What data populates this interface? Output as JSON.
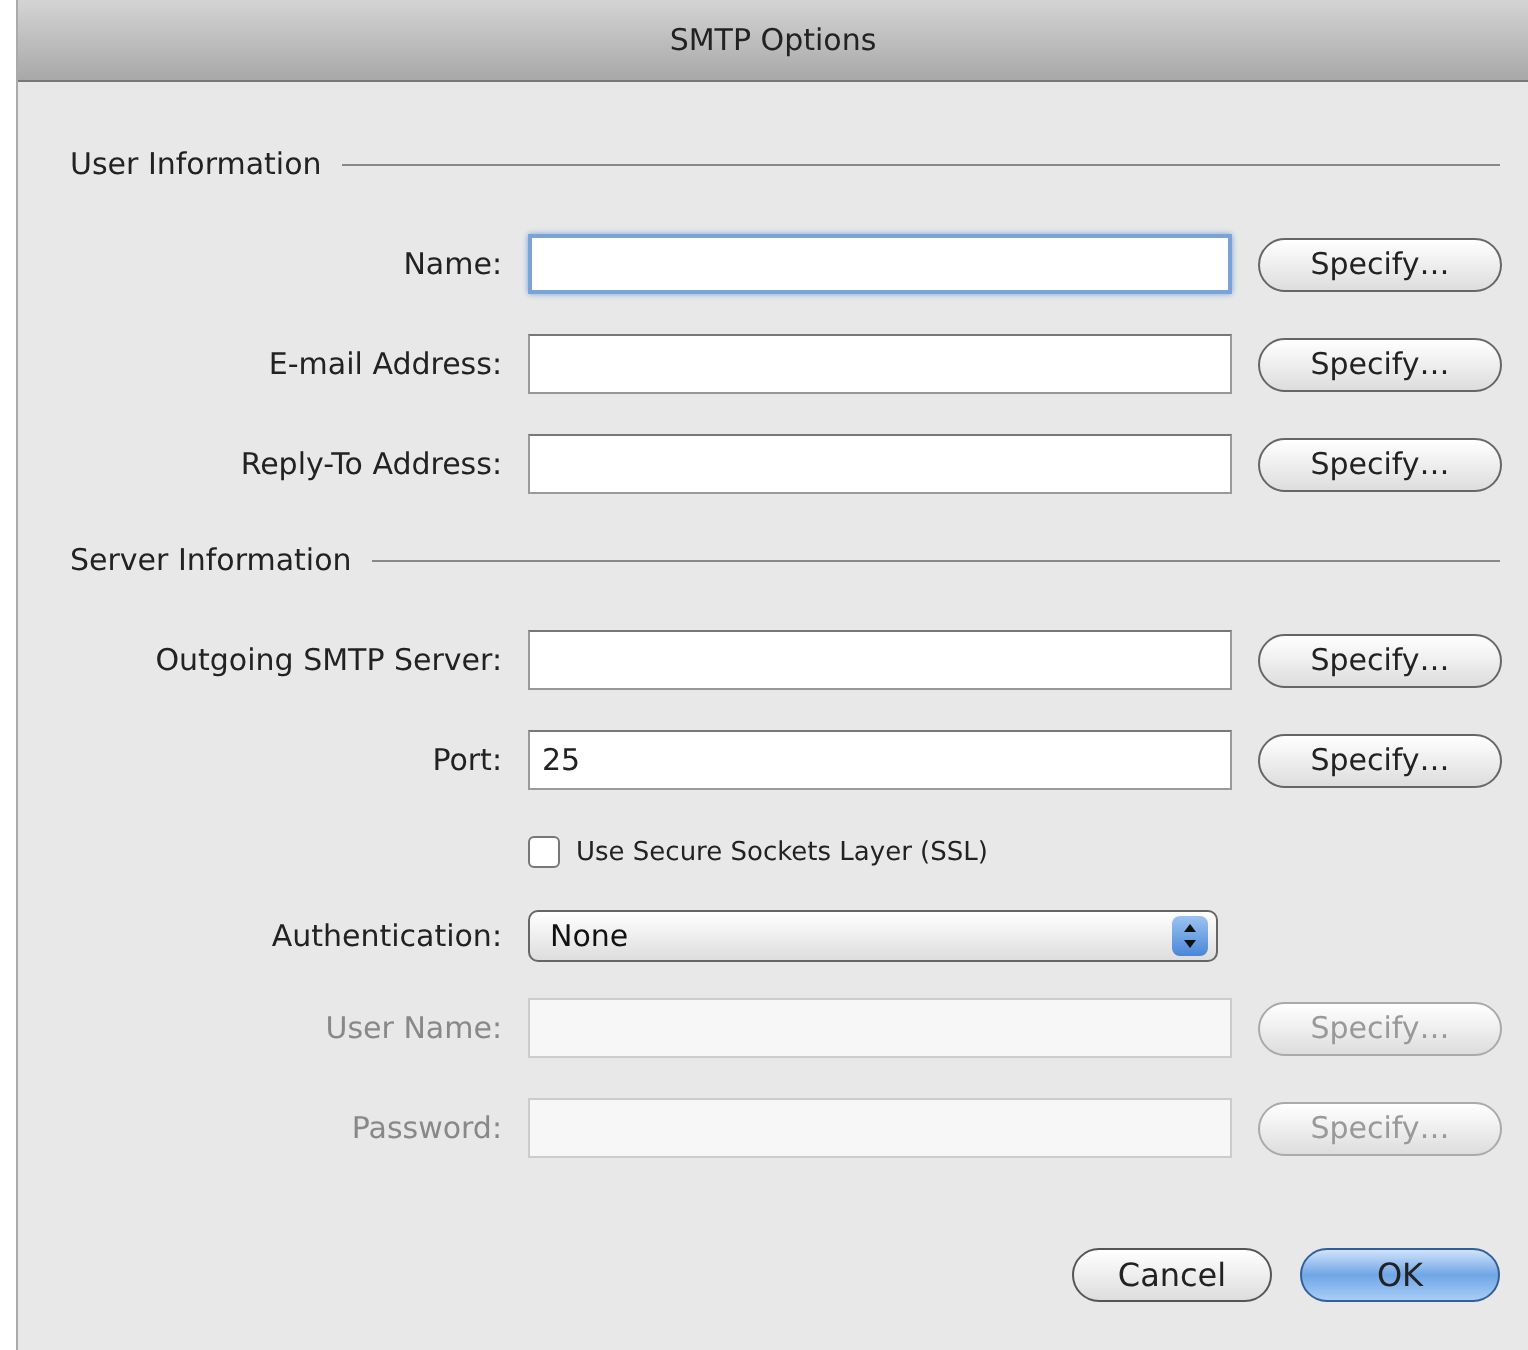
{
  "window": {
    "title": "SMTP Options"
  },
  "sections": [
    {
      "title": "User Information",
      "rows": [
        {
          "kind": "field",
          "label": "Name:",
          "focused": true,
          "disabled": false,
          "button": "Specify…"
        },
        {
          "kind": "field",
          "label": "E-mail Address:",
          "focused": false,
          "disabled": false,
          "button": "Specify…"
        },
        {
          "kind": "field",
          "label": "Reply-To Address:",
          "focused": false,
          "disabled": false,
          "button": "Specify…"
        }
      ]
    },
    {
      "title": "Server Information",
      "rows": [
        {
          "kind": "field",
          "label": "Outgoing SMTP Server:",
          "focused": false,
          "disabled": false,
          "button": "Specify…"
        },
        {
          "kind": "field",
          "label": "Port:",
          "value": "25",
          "focused": false,
          "disabled": false,
          "button": "Specify…"
        },
        {
          "kind": "checkbox",
          "label": "Use Secure Sockets Layer (SSL)",
          "checked": false
        },
        {
          "kind": "select",
          "label": "Authentication:",
          "value": "None"
        },
        {
          "kind": "field",
          "label": "User Name:",
          "focused": false,
          "disabled": true,
          "button": "Specify…"
        },
        {
          "kind": "field",
          "label": "Password:",
          "focused": false,
          "disabled": true,
          "button": "Specify…"
        }
      ]
    }
  ],
  "buttons": [
    {
      "label": "Cancel",
      "default": false
    },
    {
      "label": "OK",
      "default": true
    }
  ]
}
